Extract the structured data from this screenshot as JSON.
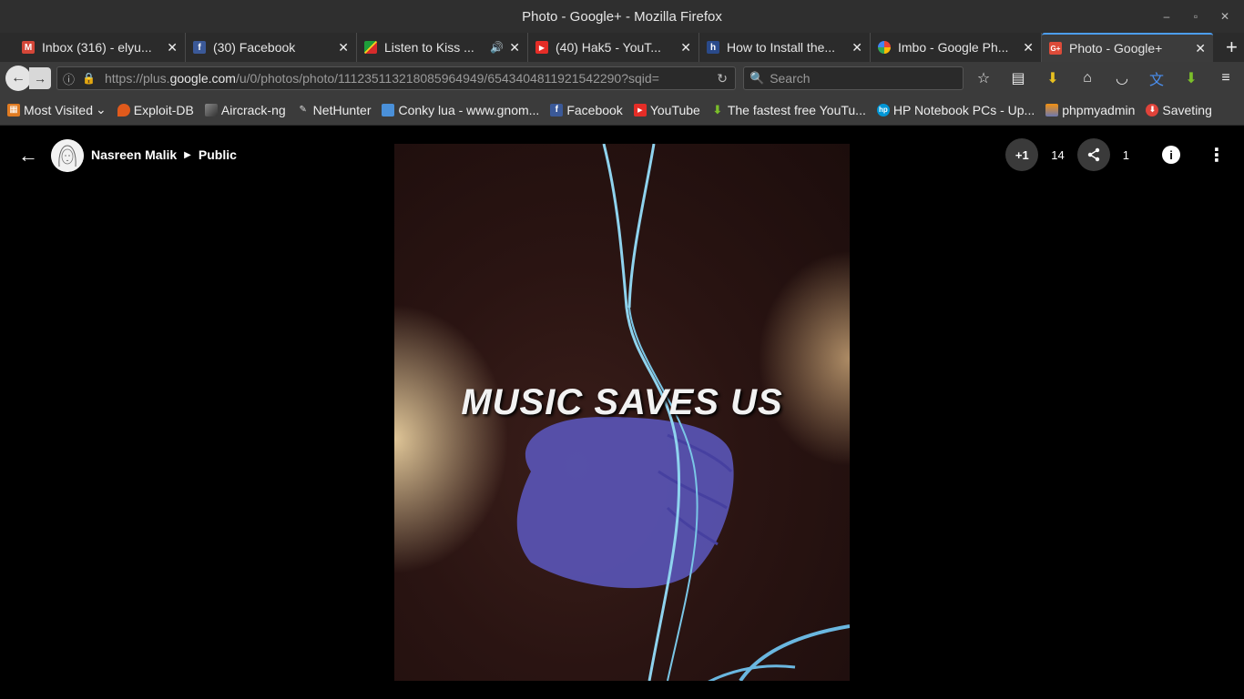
{
  "window": {
    "title": "Photo - Google+ - Mozilla Firefox",
    "controls": [
      "–",
      "▫",
      "✕"
    ]
  },
  "tabs": [
    {
      "label": "Inbox (316) - elyu...",
      "icon": "gmail-icon",
      "color": "#d44638",
      "glyph": "M"
    },
    {
      "label": "(30) Facebook",
      "icon": "facebook-icon",
      "color": "#3b5998",
      "glyph": "f"
    },
    {
      "label": "Listen to Kiss ...",
      "icon": "flag-icon",
      "color": "#1e9e3a",
      "glyph": ""
    },
    {
      "label": "(40) Hak5 - YouT...",
      "icon": "youtube-icon",
      "color": "#e52d27",
      "glyph": "▶"
    },
    {
      "label": "How to Install the...",
      "icon": "hubpages-icon",
      "color": "#2a4a8a",
      "glyph": "h"
    },
    {
      "label": "Imbo - Google Ph...",
      "icon": "google-photos-icon",
      "color": "#f4b400",
      "glyph": "✱"
    },
    {
      "label": "Photo - Google+",
      "icon": "google-plus-icon",
      "color": "#dd4b39",
      "glyph": "G+",
      "active": true
    }
  ],
  "navbar": {
    "url_prefix": "https://plus.",
    "url_domain": "google.com",
    "url_suffix": "/u/0/photos/photo/111235113218085964949/6543404811921542290?sqid=",
    "search_placeholder": "Search"
  },
  "bookmarks": [
    {
      "label": "Most Visited",
      "icon": "most-visited-icon",
      "color": "#e07b22",
      "glyph": "▦",
      "caret": "⌄"
    },
    {
      "label": "Exploit-DB",
      "icon": "exploit-db-icon",
      "color": "#e05a1c",
      "glyph": ""
    },
    {
      "label": "Aircrack-ng",
      "icon": "aircrack-icon",
      "color": "#555555",
      "glyph": ""
    },
    {
      "label": "NetHunter",
      "icon": "nethunter-icon",
      "color": "#222222",
      "glyph": ""
    },
    {
      "label": "Conky lua - www.gnom...",
      "icon": "gnome-icon",
      "color": "#4a90d9",
      "glyph": ""
    },
    {
      "label": "Facebook",
      "icon": "facebook-icon",
      "color": "#3b5998",
      "glyph": "f"
    },
    {
      "label": "YouTube",
      "icon": "youtube-icon",
      "color": "#e52d27",
      "glyph": "▶"
    },
    {
      "label": "The fastest free YouTu...",
      "icon": "download-arrow-icon",
      "color": "#7bbf2a",
      "glyph": "⬇"
    },
    {
      "label": "HP Notebook PCs - Up...",
      "icon": "hp-icon",
      "color": "#0096d6",
      "glyph": "hp"
    },
    {
      "label": "phpmyadmin",
      "icon": "phpmyadmin-icon",
      "color": "#f29111",
      "glyph": ""
    },
    {
      "label": "Saveting",
      "icon": "saveting-icon",
      "color": "#e0433a",
      "glyph": "⬇"
    }
  ],
  "viewer": {
    "author": "Nasreen Malik",
    "visibility": "Public",
    "photo_text": "MUSIC SAVES US",
    "plus_one_label": "+1",
    "plus_one_count": "14",
    "share_count": "1"
  }
}
